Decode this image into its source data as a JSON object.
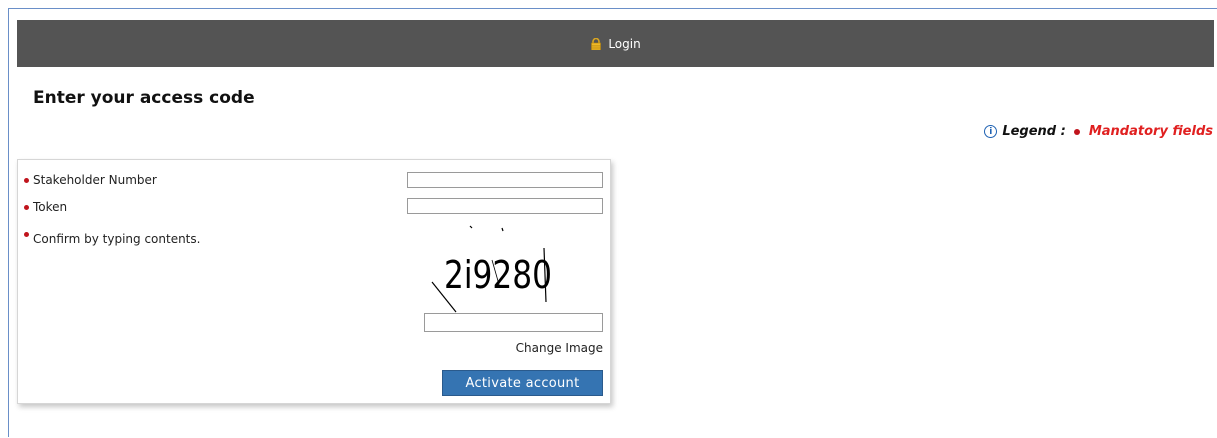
{
  "header": {
    "title": "Login",
    "icon": "lock-icon"
  },
  "page": {
    "heading": "Enter your access code"
  },
  "legend": {
    "label": "Legend :",
    "mandatory_text": "Mandatory fields",
    "mandatory_color": "#e02020"
  },
  "form": {
    "stakeholder_label": "Stakeholder Number",
    "stakeholder_value": "",
    "token_label": "Token",
    "token_value": "",
    "confirm_label": "Confirm by typing contents.",
    "captcha_text": "2i9280",
    "captcha_value": "",
    "change_image": "Change Image",
    "submit_label": "Activate account"
  },
  "colors": {
    "header_bg": "#545454",
    "button_bg": "#3574b2",
    "bullet": "#c0141c"
  }
}
